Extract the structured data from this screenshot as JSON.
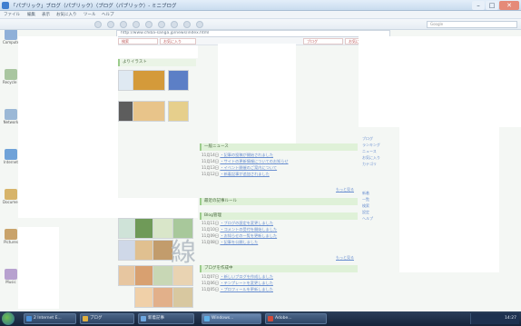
{
  "window": {
    "title": "「パブリック」ブログ（パブリック）（ブログ（パブリック）- ミニブログ",
    "min_label": "–",
    "max_label": "□",
    "close_label": "✕"
  },
  "menu": [
    "ファイル",
    "編集",
    "表示",
    "お気に入り",
    "ツール",
    "ヘルプ"
  ],
  "search": {
    "placeholder": "Google"
  },
  "address": {
    "value": "http://www.chiba-sanga.jp/news/index.html"
  },
  "links": [
    "検索",
    "お気に入り",
    "ブログ",
    "お気に入り"
  ],
  "page": {
    "top_header": "よりイラスト",
    "sections": [
      {
        "title": "一般ニュース"
      },
      {
        "title": "最近の記事ルール"
      },
      {
        "title": "Blog管理"
      },
      {
        "title": "ブログを作成中"
      }
    ],
    "news": [
      {
        "date": "11月14日",
        "text": "・記事の投稿が開始されました"
      },
      {
        "date": "11月14日",
        "text": "・サイトの更新情報についてのお知らせ"
      },
      {
        "date": "11月13日",
        "text": "・イベント開催のご案内について"
      },
      {
        "date": "11月12日",
        "text": "・新着記事が追加されました"
      }
    ],
    "blog_news": [
      {
        "date": "11月11日",
        "text": "・ブログの設定を変更しました"
      },
      {
        "date": "11月10日",
        "text": "・コメントの受付を開始しました"
      },
      {
        "date": "11月09日",
        "text": "・お知らせの一覧を更新しました"
      },
      {
        "date": "11月08日",
        "text": "・記事を公開しました"
      }
    ],
    "create_news": [
      {
        "date": "11月07日",
        "text": "・新しいブログを作成しました"
      },
      {
        "date": "11月06日",
        "text": "・テンプレートを変更しました"
      },
      {
        "date": "11月05日",
        "text": "・プロフィールを更新しました"
      }
    ],
    "more_label": "もっと見る",
    "big_char": "線",
    "right_links": [
      "ブログ",
      "ランキング",
      "ニュース",
      "お気に入り",
      "カテゴリ",
      "新着",
      "一覧",
      "検索",
      "設定",
      "ヘルプ"
    ]
  },
  "taskbar": {
    "buttons": [
      "2 Internet E...",
      "ブログ",
      "新着記事",
      "Windows...",
      "Adobe..."
    ],
    "clock": "14:27"
  },
  "desktop_icons": [
    "Computer",
    "Recycle Bin",
    "Network",
    "Internet",
    "Documents",
    "Pictures",
    "Music"
  ]
}
